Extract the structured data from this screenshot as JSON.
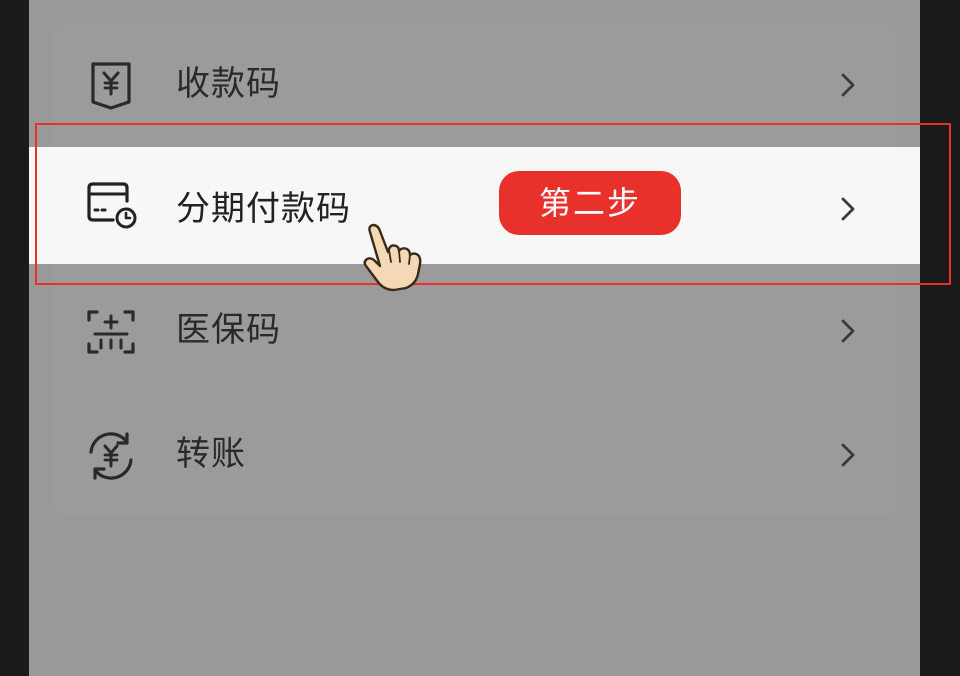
{
  "menu": {
    "items": [
      {
        "label": "收款码",
        "icon": "yuan-receipt-icon"
      },
      {
        "label": "分期付款码",
        "icon": "card-clock-icon"
      },
      {
        "label": "医保码",
        "icon": "medical-scan-icon"
      },
      {
        "label": "转账",
        "icon": "yuan-transfer-icon"
      }
    ]
  },
  "annotation": {
    "badge_label": "第二步",
    "box_color": "#e8312b",
    "pointer": "hand-pointer-icon"
  }
}
